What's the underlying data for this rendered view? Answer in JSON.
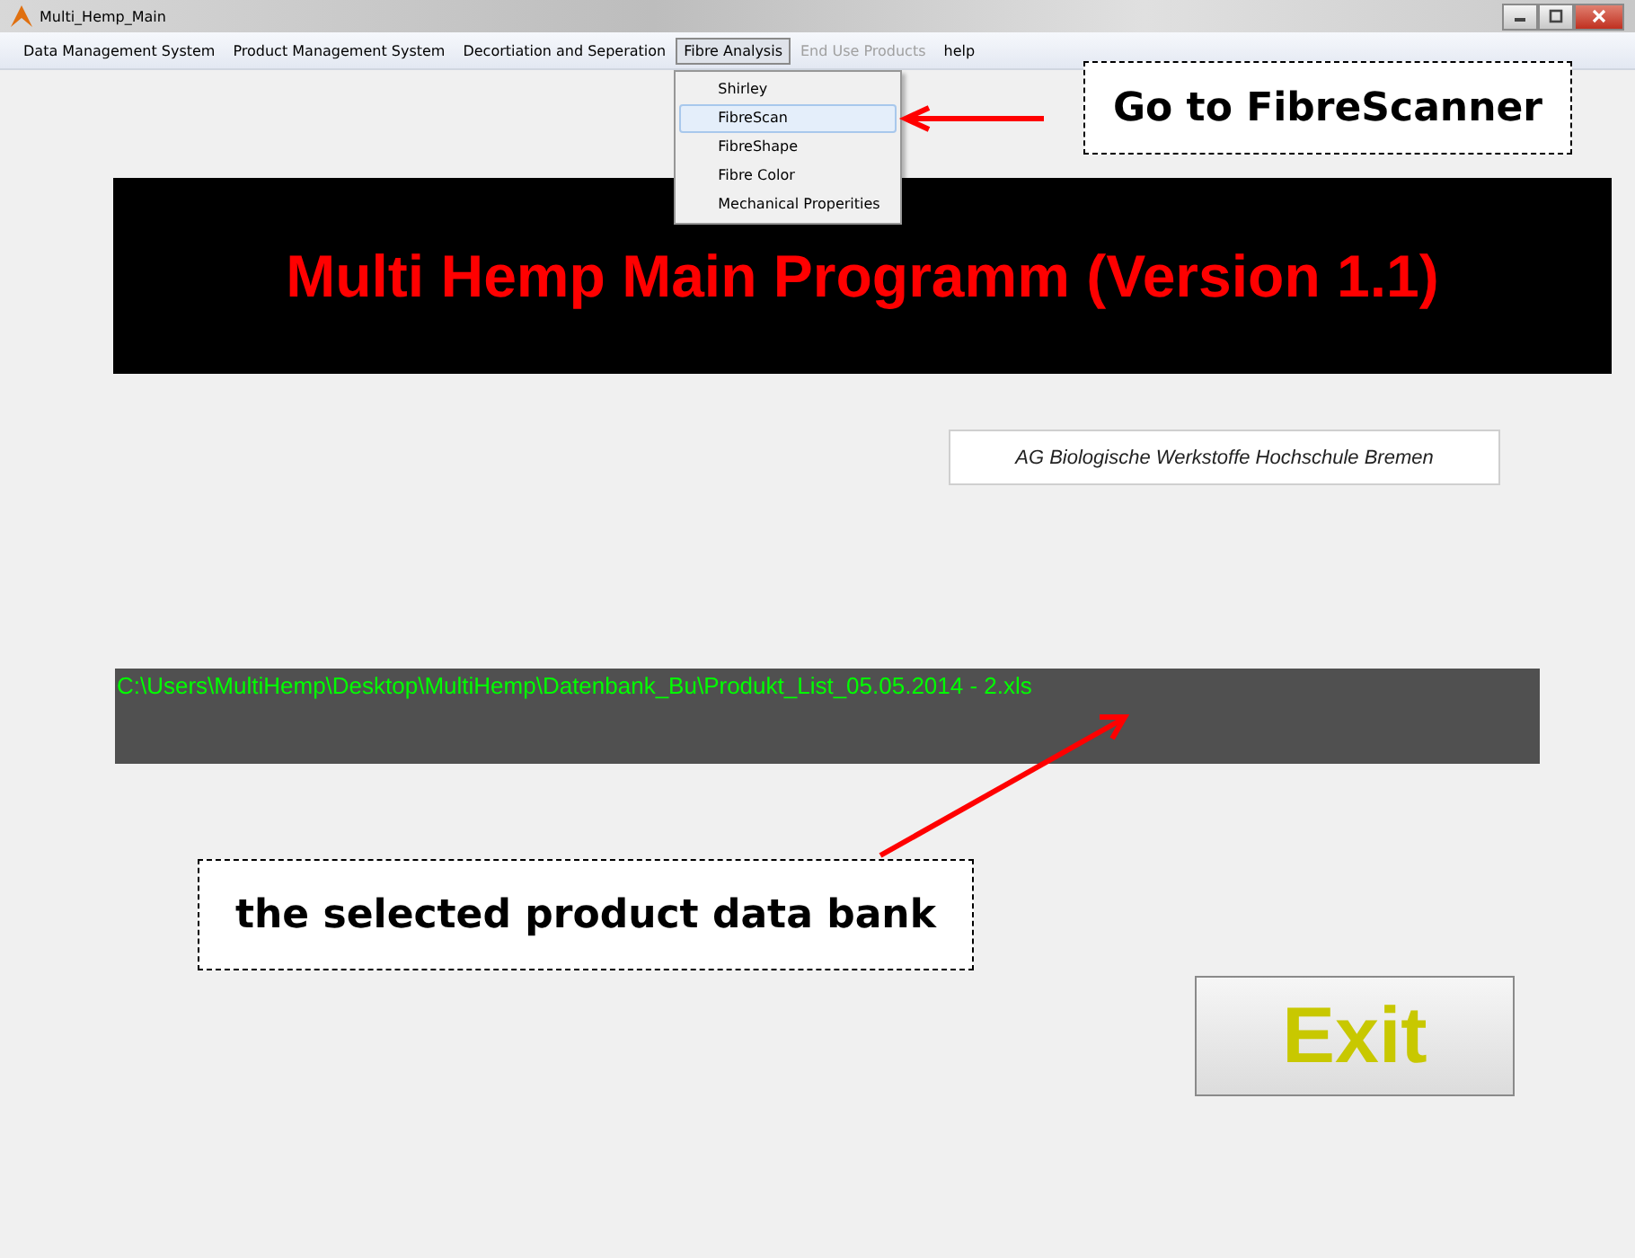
{
  "window": {
    "title": "Multi_Hemp_Main"
  },
  "menu": [
    {
      "label": "Data Management System",
      "selected": false,
      "disabled": false
    },
    {
      "label": "Product Management System",
      "selected": false,
      "disabled": false
    },
    {
      "label": "Decortiation and Seperation",
      "selected": false,
      "disabled": false
    },
    {
      "label": "Fibre Analysis",
      "selected": true,
      "disabled": false,
      "submenu": [
        {
          "label": "Shirley",
          "selected": false
        },
        {
          "label": "FibreScan",
          "selected": true
        },
        {
          "label": "FibreShape",
          "selected": false
        },
        {
          "label": "Fibre Color",
          "selected": false
        },
        {
          "label": "Mechanical Properities",
          "selected": false
        }
      ]
    },
    {
      "label": "End Use Products",
      "selected": false,
      "disabled": true
    },
    {
      "label": "help",
      "selected": false,
      "disabled": false
    }
  ],
  "banner": {
    "title": "Multi Hemp Main Programm (Version 1.1)"
  },
  "affiliation": "AG Biologische Werkstoffe  Hochschule Bremen",
  "file_path": "C:\\Users\\MultiHemp\\Desktop\\MultiHemp\\Datenbank_Bu\\Produkt_List_05.05.2014 - 2.xls",
  "exit_button": "Exit",
  "annotations": [
    {
      "kind": "menu",
      "text": "Go to FibreScanner"
    },
    {
      "kind": "path",
      "text": "the selected product data bank"
    }
  ]
}
